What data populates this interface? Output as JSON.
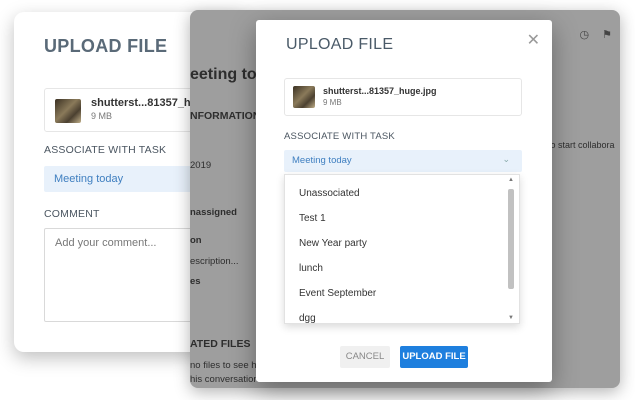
{
  "back_panel": {
    "title": "UPLOAD FILE",
    "file_name": "shutterst...81357_huge.j",
    "file_size": "9 MB",
    "associate_label": "ASSOCIATE WITH TASK",
    "selected_task": "Meeting today",
    "comment_label": "COMMENT",
    "comment_placeholder": "Add your comment..."
  },
  "background_page": {
    "heading": "eeting tod",
    "information": "NFORMATION",
    "date": "2019",
    "assignee": "nassigned",
    "on": "on",
    "description": "escription...",
    "es": "es",
    "related_files": "ATED FILES",
    "no_files_1": "no files to see he",
    "no_files_2": "his conversation.",
    "collab_hint": "nt to start collabora"
  },
  "modal": {
    "title": "UPLOAD FILE",
    "file_name": "shutterst...81357_huge.jpg",
    "file_size": "9 MB",
    "associate_label": "ASSOCIATE WITH TASK",
    "selected_task": "Meeting today",
    "dropdown_options": [
      "Unassociated",
      "Test 1",
      "New Year party",
      "lunch",
      "Event September",
      "dgg"
    ],
    "cancel_label": "CANCEL",
    "upload_label": "UPLOAD FILE"
  },
  "icons": {
    "close": "close-icon",
    "tag": "tag-icon",
    "flag": "flag-icon",
    "chevron": "chevron-down-icon"
  }
}
